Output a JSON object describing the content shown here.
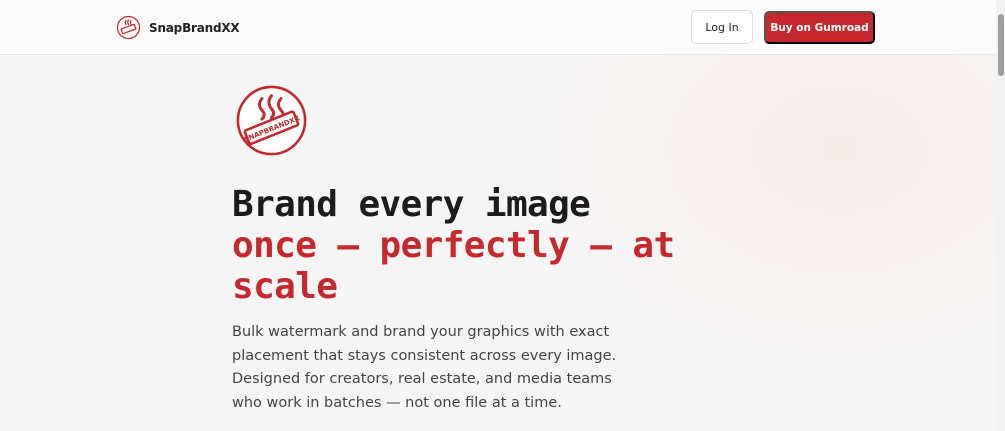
{
  "header": {
    "brand_name": "SnapBrandXX",
    "login_label": "Log In",
    "buy_label": "Buy on Gumroad"
  },
  "hero": {
    "logo_text": "SNAPBRANDXX",
    "title_line1": "Brand every image",
    "title_accent": "once — perfectly — at scale",
    "lead": "Bulk watermark and brand your graphics with exact placement that stays consistent across every image. Designed for creators, real estate, and media teams who work in batches — not one file at a time."
  },
  "colors": {
    "accent": "#c5282d",
    "text": "#1c1c1c",
    "muted": "#444444"
  },
  "icons": [
    "brand-logo-icon",
    "hero-logo-icon"
  ]
}
